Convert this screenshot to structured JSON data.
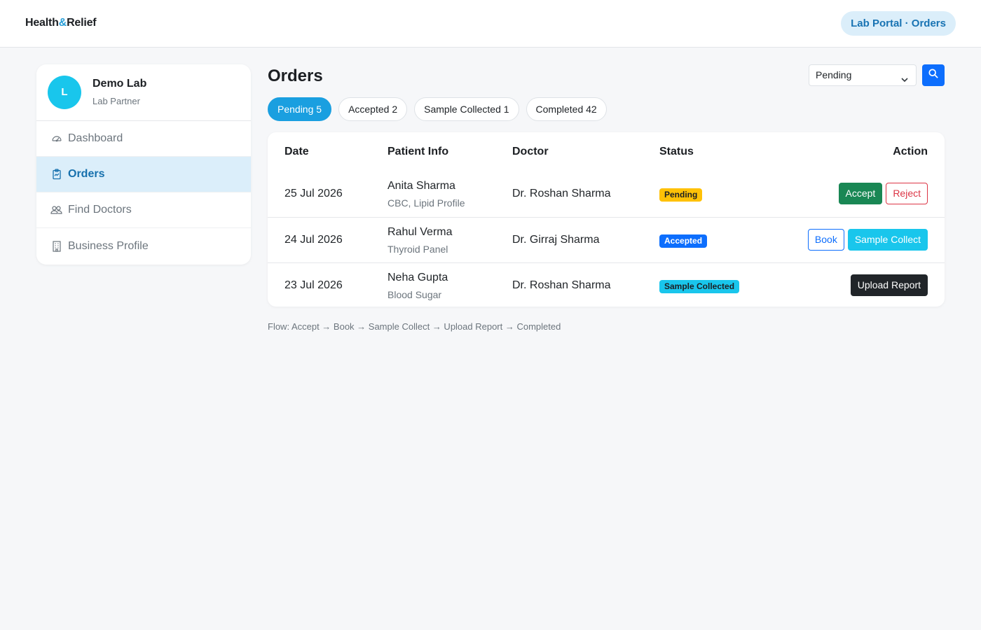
{
  "header": {
    "brand_part1": "Health",
    "brand_amp": "&",
    "brand_part2": "Relief",
    "portal_label": "Lab Portal · Orders"
  },
  "sidebar": {
    "avatar_initial": "L",
    "profile_name": "Demo Lab",
    "profile_role": "Lab Partner",
    "items": [
      {
        "label": "Dashboard",
        "icon": "speedometer-icon",
        "active": false
      },
      {
        "label": "Orders",
        "icon": "clipboard-icon",
        "active": true
      },
      {
        "label": "Find Doctors",
        "icon": "people-icon",
        "active": false
      },
      {
        "label": "Business Profile",
        "icon": "building-icon",
        "active": false
      }
    ]
  },
  "main": {
    "title": "Orders",
    "filter_value": "Pending",
    "tabs": [
      {
        "label": "Pending 5",
        "active": true
      },
      {
        "label": "Accepted 2",
        "active": false
      },
      {
        "label": "Sample Collected 1",
        "active": false
      },
      {
        "label": "Completed 42",
        "active": false
      }
    ],
    "table": {
      "headers": {
        "date": "Date",
        "patient": "Patient Info",
        "doctor": "Doctor",
        "status": "Status",
        "action": "Action"
      },
      "rows": [
        {
          "date": "25 Jul 2026",
          "patient": "Anita Sharma",
          "tests": "CBC, Lipid Profile",
          "doctor": "Dr. Roshan Sharma",
          "status": "Pending",
          "actions": [
            "Accept",
            "Reject"
          ]
        },
        {
          "date": "24 Jul 2026",
          "patient": "Rahul Verma",
          "tests": "Thyroid Panel",
          "doctor": "Dr. Girraj Sharma",
          "status": "Accepted",
          "actions": [
            "Book",
            "Sample Collect"
          ]
        },
        {
          "date": "23 Jul 2026",
          "patient": "Neha Gupta",
          "tests": "Blood Sugar",
          "doctor": "Dr. Roshan Sharma",
          "status": "Sample Collected",
          "actions": [
            "Upload Report"
          ]
        }
      ]
    },
    "flow_note": "Flow: Accept → Book → Sample Collect → Upload Report → Completed"
  },
  "colors": {
    "primary": "#0d6efd",
    "tab_active": "#1a9fe0",
    "active_nav_bg": "#dbeefa",
    "success": "#198754",
    "danger": "#dc3545",
    "warning": "#ffc107",
    "info": "#19c6ec",
    "dark": "#212529"
  }
}
